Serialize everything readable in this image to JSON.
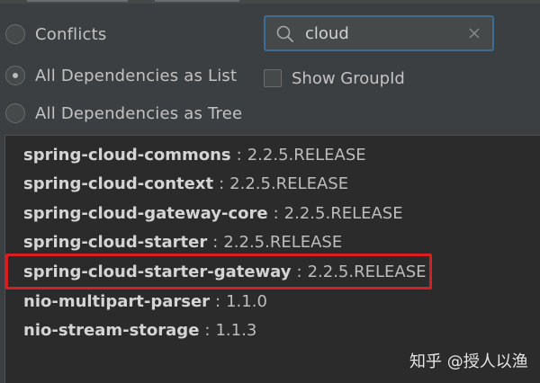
{
  "options": {
    "radios": [
      {
        "label": "Conflicts",
        "checked": false
      },
      {
        "label": "All Dependencies as List",
        "checked": true
      },
      {
        "label": "All Dependencies as Tree",
        "checked": false
      }
    ],
    "search": {
      "value": "cloud",
      "icon": "search-icon",
      "clear_icon": "clear-icon"
    },
    "show_group_id": {
      "label": "Show GroupId",
      "checked": false
    }
  },
  "dependencies": [
    {
      "name": "spring-cloud-commons",
      "separator": ":",
      "version": "2.2.5.RELEASE"
    },
    {
      "name": "spring-cloud-context",
      "separator": ":",
      "version": "2.2.5.RELEASE"
    },
    {
      "name": "spring-cloud-gateway-core",
      "separator": ":",
      "version": "2.2.5.RELEASE"
    },
    {
      "name": "spring-cloud-starter",
      "separator": ":",
      "version": "2.2.5.RELEASE"
    },
    {
      "name": "spring-cloud-starter-gateway",
      "separator": ":",
      "version": "2.2.5.RELEASE",
      "highlighted": true
    },
    {
      "name": "nio-multipart-parser",
      "separator": ":",
      "version": "1.1.0"
    },
    {
      "name": "nio-stream-storage",
      "separator": ":",
      "version": "1.1.3"
    }
  ],
  "watermark": {
    "text": "知乎 @授人以渔"
  },
  "colors": {
    "accent": "#3d6d92",
    "highlight": "#d61f1f",
    "background": "#3c3f41",
    "list_background": "#2b2b2b"
  }
}
